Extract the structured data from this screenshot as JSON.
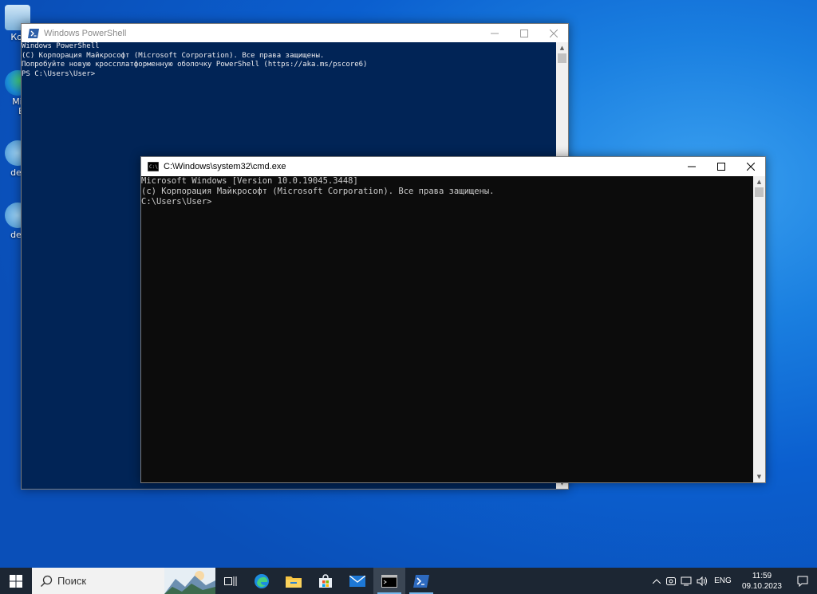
{
  "desktop": {
    "icons": [
      {
        "label": "Корз"
      },
      {
        "label": "Micro Ed"
      },
      {
        "label": "desk"
      },
      {
        "label": "desk"
      }
    ]
  },
  "powershell": {
    "title": "Windows PowerShell",
    "lines": [
      "Windows PowerShell",
      "(C) Корпорация Майкрософт (Microsoft Corporation). Все права защищены.",
      "",
      "Попробуйте новую кроссплатформенную оболочку PowerShell (https://aka.ms/pscore6)",
      "",
      "PS C:\\Users\\User>"
    ],
    "bg_color": "#012456"
  },
  "cmd": {
    "title": "C:\\Windows\\system32\\cmd.exe",
    "lines": [
      "Microsoft Windows [Version 10.0.19045.3448]",
      "(c) Корпорация Майкрософт (Microsoft Corporation). Все права защищены.",
      "",
      "C:\\Users\\User>"
    ],
    "bg_color": "#0c0c0c"
  },
  "taskbar": {
    "search_placeholder": "Поиск",
    "apps": [
      "task-view",
      "edge",
      "file-explorer",
      "store",
      "mail",
      "cmd",
      "powershell"
    ],
    "active": [
      "cmd",
      "powershell"
    ],
    "tray": {
      "language": "ENG",
      "time": "11:59",
      "date": "09.10.2023"
    }
  }
}
